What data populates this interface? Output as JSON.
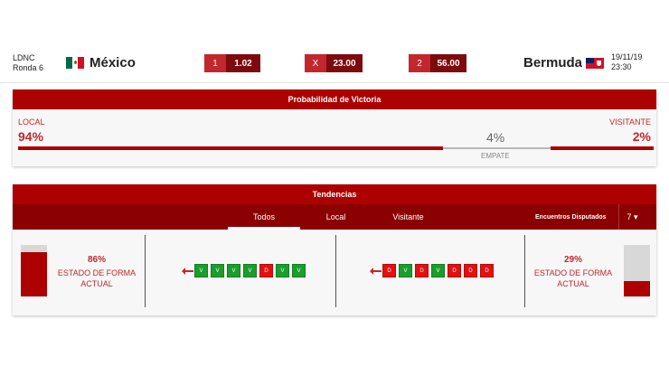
{
  "match": {
    "competition": "LDNC",
    "round": "Ronda 6",
    "home_team": "México",
    "away_team": "Bermuda",
    "date": "19/11/19",
    "time": "23:30"
  },
  "odds": [
    {
      "key": "1",
      "value": "1.02"
    },
    {
      "key": "X",
      "value": "23.00"
    },
    {
      "key": "2",
      "value": "56.00"
    }
  ],
  "probabilities": {
    "title": "Probabilidad de Victoria",
    "local_label": "LOCAL",
    "local_pct": "94%",
    "draw_pct": "4%",
    "draw_label": "EMPATE",
    "away_label": "VISITANTE",
    "away_pct": "2%",
    "local_value": 0.94,
    "draw_value": 0.04,
    "away_value": 0.02
  },
  "tendencies": {
    "title": "Tendencias",
    "tabs": [
      "Todos",
      "Local",
      "Visitante"
    ],
    "active_tab": "Todos",
    "matches_label": "Encuentros Disputados",
    "matches_value": "7 ▾",
    "home": {
      "form_pct": "86%",
      "form_label": "ESTADO DE FORMA ACTUAL",
      "form_value": 0.86,
      "results": [
        "V",
        "V",
        "V",
        "V",
        "D",
        "V",
        "V"
      ]
    },
    "away": {
      "form_pct": "29%",
      "form_label": "ESTADO DE FORMA ACTUAL",
      "form_value": 0.29,
      "results": [
        "D",
        "V",
        "D",
        "V",
        "D",
        "D",
        "D"
      ]
    }
  },
  "colors": {
    "primary": "#ad0000",
    "primary_dark": "#8b0000",
    "win": "#1a9e2a",
    "loss": "#e31010"
  }
}
